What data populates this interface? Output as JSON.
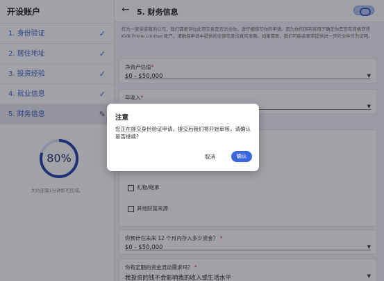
{
  "sidebar": {
    "title": "开设账户",
    "steps": [
      {
        "label": "1. 身份验证",
        "status": "done"
      },
      {
        "label": "2. 居住地址",
        "status": "done"
      },
      {
        "label": "3. 投资经验",
        "status": "done"
      },
      {
        "label": "4. 就业信息",
        "status": "done"
      },
      {
        "label": "5. 财务信息",
        "status": "editing"
      }
    ],
    "progress": {
      "percent": 0.8,
      "label": "80%",
      "caption": "大约还需1分钟即可完成。"
    }
  },
  "header": {
    "back_icon": "arrow-left-icon",
    "title": "5. 财务信息"
  },
  "intro": "作为一家受监管的公司，我们需要评估此项交易是否适合你。请仔细填写你的申请。因为你的回答将用于确定你是否有资格获得 KVB Prime Limited 账户。请确保申请中提供的全部信息均真实准确。如果需要，我们可能会要求提供进一步的文件作为证明。",
  "fields": {
    "net_worth": {
      "label": "净资产估值",
      "required": "*",
      "value": "$0 - $50,000"
    },
    "annual_income": {
      "label": "年收入",
      "required": "*"
    },
    "deposit": {
      "label": "你预计在未来 12 个月内存入多少资金？",
      "required": "*",
      "value": "$0 - $50,000"
    },
    "liquidity": {
      "label": "你有定期的资金流动需求吗？",
      "required": "*",
      "value": "我投资的钱不会影响我的收入或生活水平"
    }
  },
  "options": [
    "礼物/继承",
    "其他财富来源"
  ],
  "dialog": {
    "title": "注意",
    "message": "您正在提交身份验证申请，提交后我们将开始审核，请确认是否继续?",
    "cancel_label": "取消",
    "confirm_label": "确认"
  },
  "colors": {
    "accent": "#3a67e0",
    "step_text": "#3b5fc5",
    "progress_ring": "#1f3fa8"
  }
}
